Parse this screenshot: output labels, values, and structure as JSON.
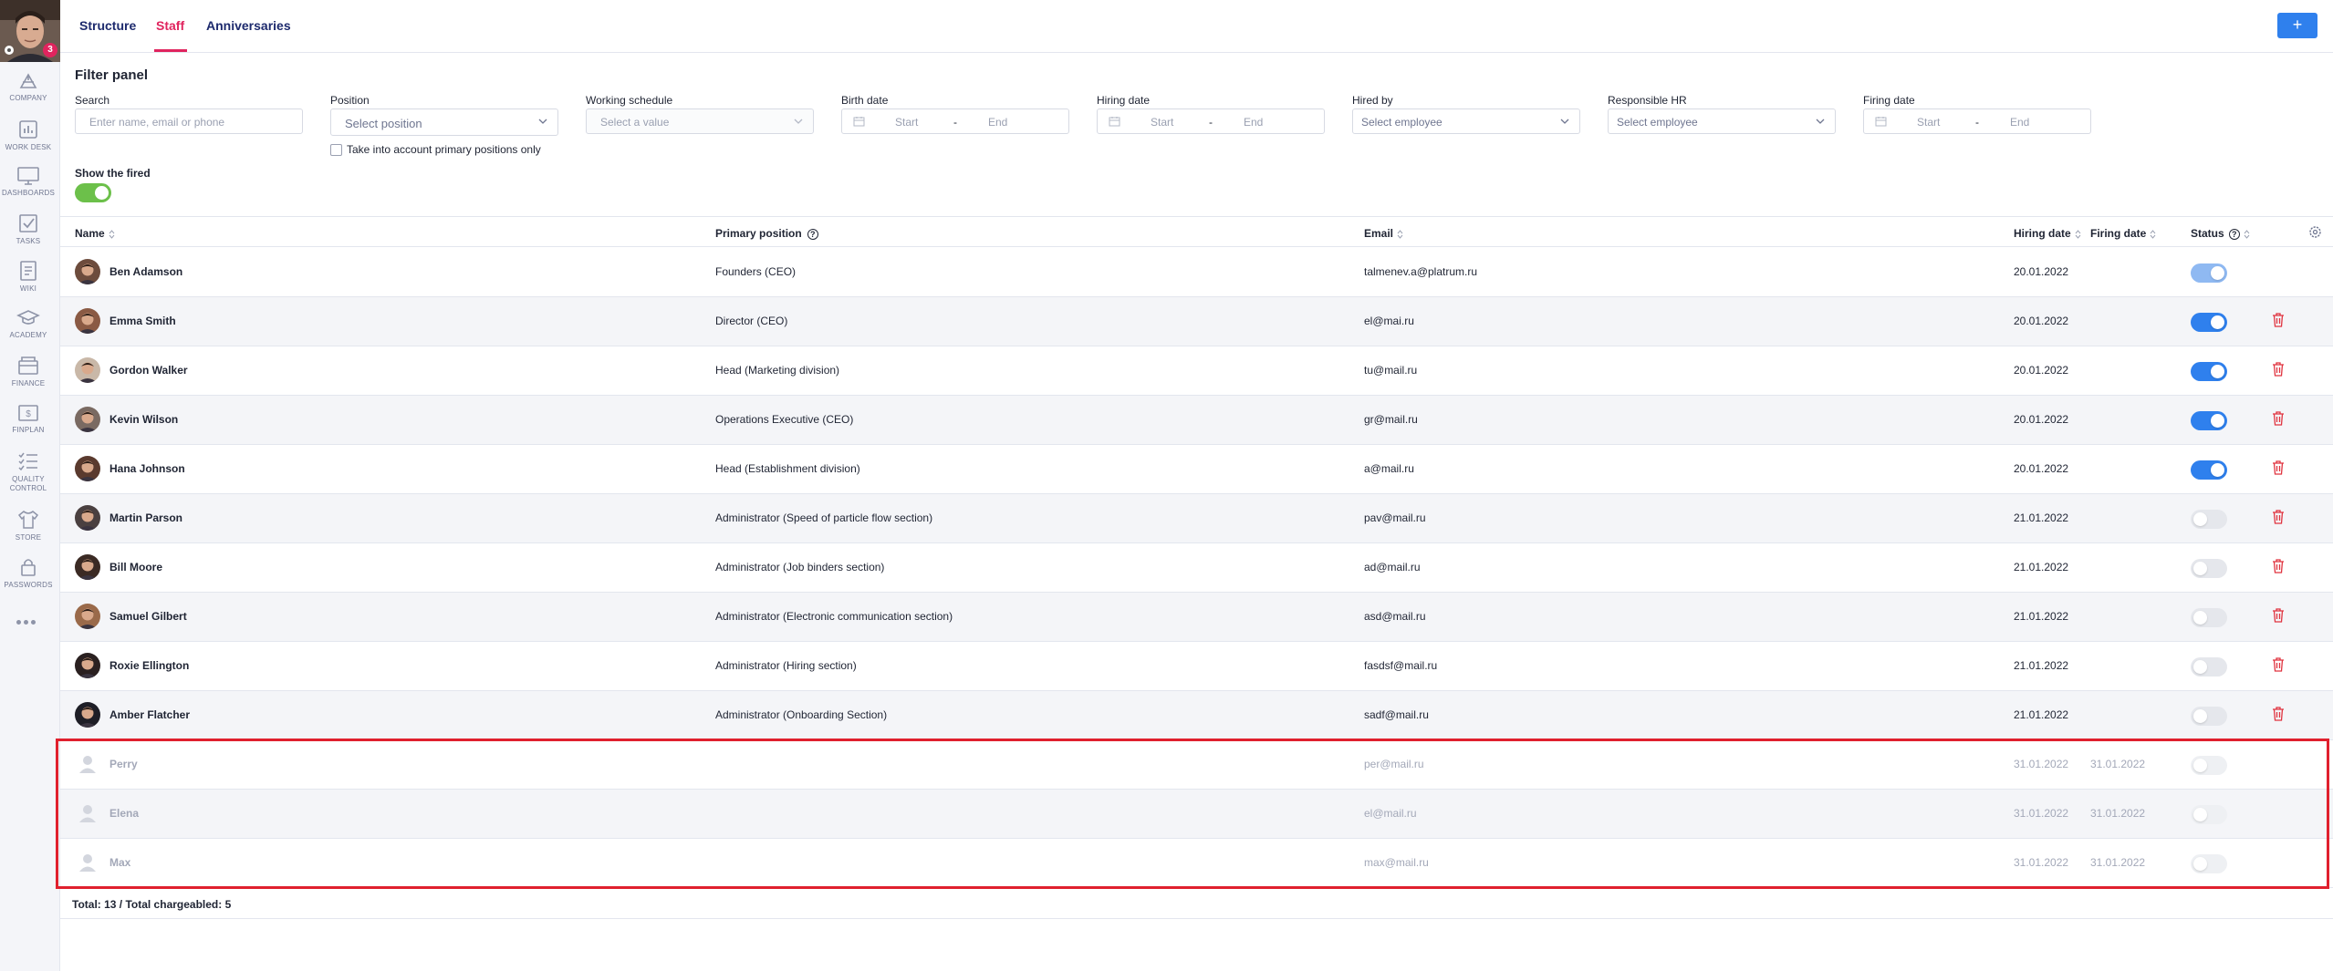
{
  "user": {
    "notifications": "3"
  },
  "sidebar": {
    "items": [
      {
        "label": "COMPANY",
        "icon": "company-icon"
      },
      {
        "label": "WORK DESK",
        "icon": "work-desk-icon"
      },
      {
        "label": "DASHBOARDS",
        "icon": "dashboards-icon"
      },
      {
        "label": "TASKS",
        "icon": "tasks-icon"
      },
      {
        "label": "WIKI",
        "icon": "wiki-icon"
      },
      {
        "label": "ACADEMY",
        "icon": "academy-icon"
      },
      {
        "label": "FINANCE",
        "icon": "finance-icon"
      },
      {
        "label": "FINPLAN",
        "icon": "finplan-icon"
      },
      {
        "label": "QUALITY",
        "label2": "CONTROL",
        "icon": "quality-control-icon"
      },
      {
        "label": "STORE",
        "icon": "store-icon"
      },
      {
        "label": "PASSWORDS",
        "icon": "passwords-icon"
      }
    ]
  },
  "tabs": [
    {
      "label": "Structure"
    },
    {
      "label": "Staff",
      "active": true
    },
    {
      "label": "Anniversaries"
    }
  ],
  "add_button": "+",
  "filter": {
    "title": "Filter panel",
    "search": {
      "label": "Search",
      "placeholder": "Enter name, email or phone"
    },
    "position": {
      "label": "Position",
      "placeholder": "Select position"
    },
    "primary_only": "Take into account primary positions only",
    "schedule": {
      "label": "Working schedule",
      "placeholder": "Select a value"
    },
    "birth": {
      "label": "Birth date",
      "start": "Start",
      "sep": "-",
      "end": "End"
    },
    "hiring": {
      "label": "Hiring date",
      "start": "Start",
      "sep": "-",
      "end": "End"
    },
    "hired_by": {
      "label": "Hired by",
      "placeholder": "Select employee"
    },
    "hr": {
      "label": "Responsible HR",
      "placeholder": "Select employee"
    },
    "firing": {
      "label": "Firing date",
      "start": "Start",
      "sep": "-",
      "end": "End"
    },
    "show_fired": {
      "label": "Show the fired",
      "value": true
    }
  },
  "table": {
    "columns": {
      "name": "Name",
      "position": "Primary position",
      "email": "Email",
      "hiring": "Hiring date",
      "firing": "Firing date",
      "status": "Status"
    },
    "rows": [
      {
        "name": "Ben Adamson",
        "position": "Founders (CEO)",
        "email": "talmenev.a@platrum.ru",
        "hiring": "20.01.2022",
        "firing": "",
        "status": "on-light",
        "deletable": false,
        "fired": false
      },
      {
        "name": "Emma Smith",
        "position": "Director (CEO)",
        "email": "el@mai.ru",
        "hiring": "20.01.2022",
        "firing": "",
        "status": "on",
        "deletable": true,
        "fired": false
      },
      {
        "name": "Gordon Walker",
        "position": "Head (Marketing division)",
        "email": "tu@mail.ru",
        "hiring": "20.01.2022",
        "firing": "",
        "status": "on",
        "deletable": true,
        "fired": false
      },
      {
        "name": "Kevin Wilson",
        "position": "Operations Executive (CEO)",
        "email": "gr@mail.ru",
        "hiring": "20.01.2022",
        "firing": "",
        "status": "on",
        "deletable": true,
        "fired": false
      },
      {
        "name": "Hana Johnson",
        "position": "Head (Establishment division)",
        "email": "a@mail.ru",
        "hiring": "20.01.2022",
        "firing": "",
        "status": "on",
        "deletable": true,
        "fired": false
      },
      {
        "name": "Martin Parson",
        "position": "Administrator (Speed of particle flow section)",
        "email": "pav@mail.ru",
        "hiring": "21.01.2022",
        "firing": "",
        "status": "off",
        "deletable": true,
        "fired": false
      },
      {
        "name": "Bill Moore",
        "position": "Administrator (Job binders section)",
        "email": "ad@mail.ru",
        "hiring": "21.01.2022",
        "firing": "",
        "status": "off",
        "deletable": true,
        "fired": false
      },
      {
        "name": "Samuel Gilbert",
        "position": "Administrator (Electronic communication section)",
        "email": "asd@mail.ru",
        "hiring": "21.01.2022",
        "firing": "",
        "status": "off",
        "deletable": true,
        "fired": false
      },
      {
        "name": "Roxie Ellington",
        "position": "Administrator (Hiring section)",
        "email": "fasdsf@mail.ru",
        "hiring": "21.01.2022",
        "firing": "",
        "status": "off",
        "deletable": true,
        "fired": false
      },
      {
        "name": "Amber Flatcher",
        "position": "Administrator (Onboarding Section)",
        "email": "sadf@mail.ru",
        "hiring": "21.01.2022",
        "firing": "",
        "status": "off",
        "deletable": true,
        "fired": false
      },
      {
        "name": "Perry",
        "position": "",
        "email": "per@mail.ru",
        "hiring": "31.01.2022",
        "firing": "31.01.2022",
        "status": "ghost",
        "deletable": false,
        "fired": true
      },
      {
        "name": "Elena",
        "position": "",
        "email": "el@mail.ru",
        "hiring": "31.01.2022",
        "firing": "31.01.2022",
        "status": "ghost",
        "deletable": false,
        "fired": true
      },
      {
        "name": "Max",
        "position": "",
        "email": "max@mail.ru",
        "hiring": "31.01.2022",
        "firing": "31.01.2022",
        "status": "ghost",
        "deletable": false,
        "fired": true
      }
    ],
    "total": "Total: 13 / Total chargeabled: 5"
  },
  "colors": {
    "accent": "#e0245e",
    "primary": "#2f80ed",
    "toggle_green": "#6cc04a",
    "delete_red": "#e0333f",
    "highlight": "#e0202e"
  }
}
